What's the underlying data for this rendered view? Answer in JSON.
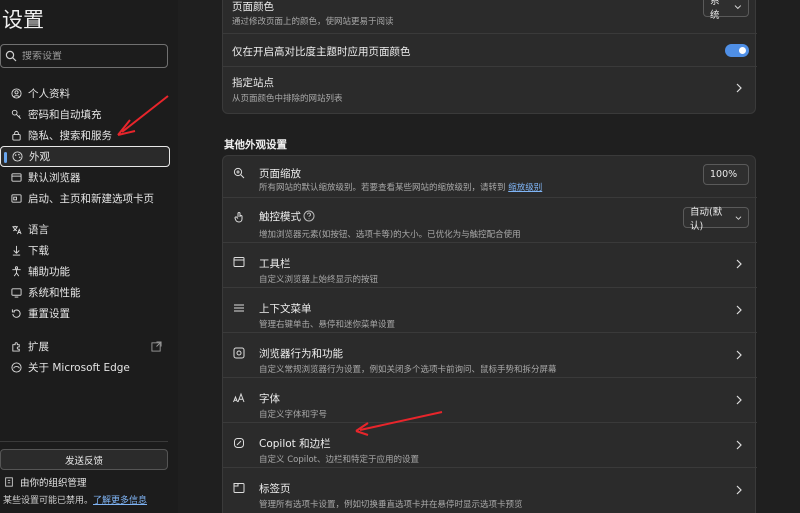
{
  "sidebar": {
    "title": "设置",
    "search_placeholder": "搜索设置",
    "items": [
      {
        "label": "个人资料",
        "icon": "profile-icon"
      },
      {
        "label": "密码和自动填充",
        "icon": "key-icon"
      },
      {
        "label": "隐私、搜索和服务",
        "icon": "lock-icon"
      },
      {
        "label": "外观",
        "icon": "palette-icon"
      },
      {
        "label": "默认浏览器",
        "icon": "browser-icon"
      },
      {
        "label": "启动、主页和新建选项卡页",
        "icon": "home-icon"
      },
      {
        "label": "语言",
        "icon": "language-icon"
      },
      {
        "label": "下载",
        "icon": "download-icon"
      },
      {
        "label": "辅助功能",
        "icon": "accessibility-icon"
      },
      {
        "label": "系统和性能",
        "icon": "system-icon"
      },
      {
        "label": "重置设置",
        "icon": "reset-icon"
      },
      {
        "label": "扩展",
        "icon": "extension-icon"
      },
      {
        "label": "关于 Microsoft Edge",
        "icon": "edge-icon"
      }
    ],
    "feedback_label": "发送反馈",
    "org_label": "由你的组织管理",
    "org_note": "某些设置可能已禁用。",
    "org_link": "了解更多信息"
  },
  "top_card": {
    "page_color_title": "页面颜色",
    "page_color_desc": "通过修改页面上的颜色，使网站更易于阅读",
    "page_color_value": "系统",
    "contrast_title": "仅在开启高对比度主题时应用页面颜色",
    "contrast_on": true,
    "sites_title": "指定站点",
    "sites_desc": "从页面颜色中排除的网站列表"
  },
  "section_title": "其他外观设置",
  "rows": {
    "zoom_title": "页面缩放",
    "zoom_desc": "所有网站的默认缩放级别。若要查看某些网站的缩放级别，请转到",
    "zoom_link": "缩放级别",
    "zoom_value": "100%",
    "touch_title": "触控模式",
    "touch_desc": "增加浏览器元素(如按钮、选项卡等)的大小。已优化为与触控配合使用",
    "touch_value": "自动(默认)",
    "toolbar_title": "工具栏",
    "toolbar_desc": "自定义浏览器上始终显示的按钮",
    "context_title": "上下文菜单",
    "context_desc": "管理右键单击、悬停和迷你菜单设置",
    "behavior_title": "浏览器行为和功能",
    "behavior_desc": "自定义常规浏览器行为设置，例如关闭多个选项卡前询问、鼠标手势和拆分屏幕",
    "font_title": "字体",
    "font_desc": "自定义字体和字号",
    "copilot_title": "Copilot 和边栏",
    "copilot_desc": "自定义 Copilot、边栏和特定于应用的设置",
    "tabs_title": "标签页",
    "tabs_desc": "管理所有选项卡设置，例如切换垂直选项卡并在悬停时显示选项卡预览"
  },
  "colors": {
    "accent": "#4f8fe6",
    "annotation_arrow": "#e8252b"
  }
}
